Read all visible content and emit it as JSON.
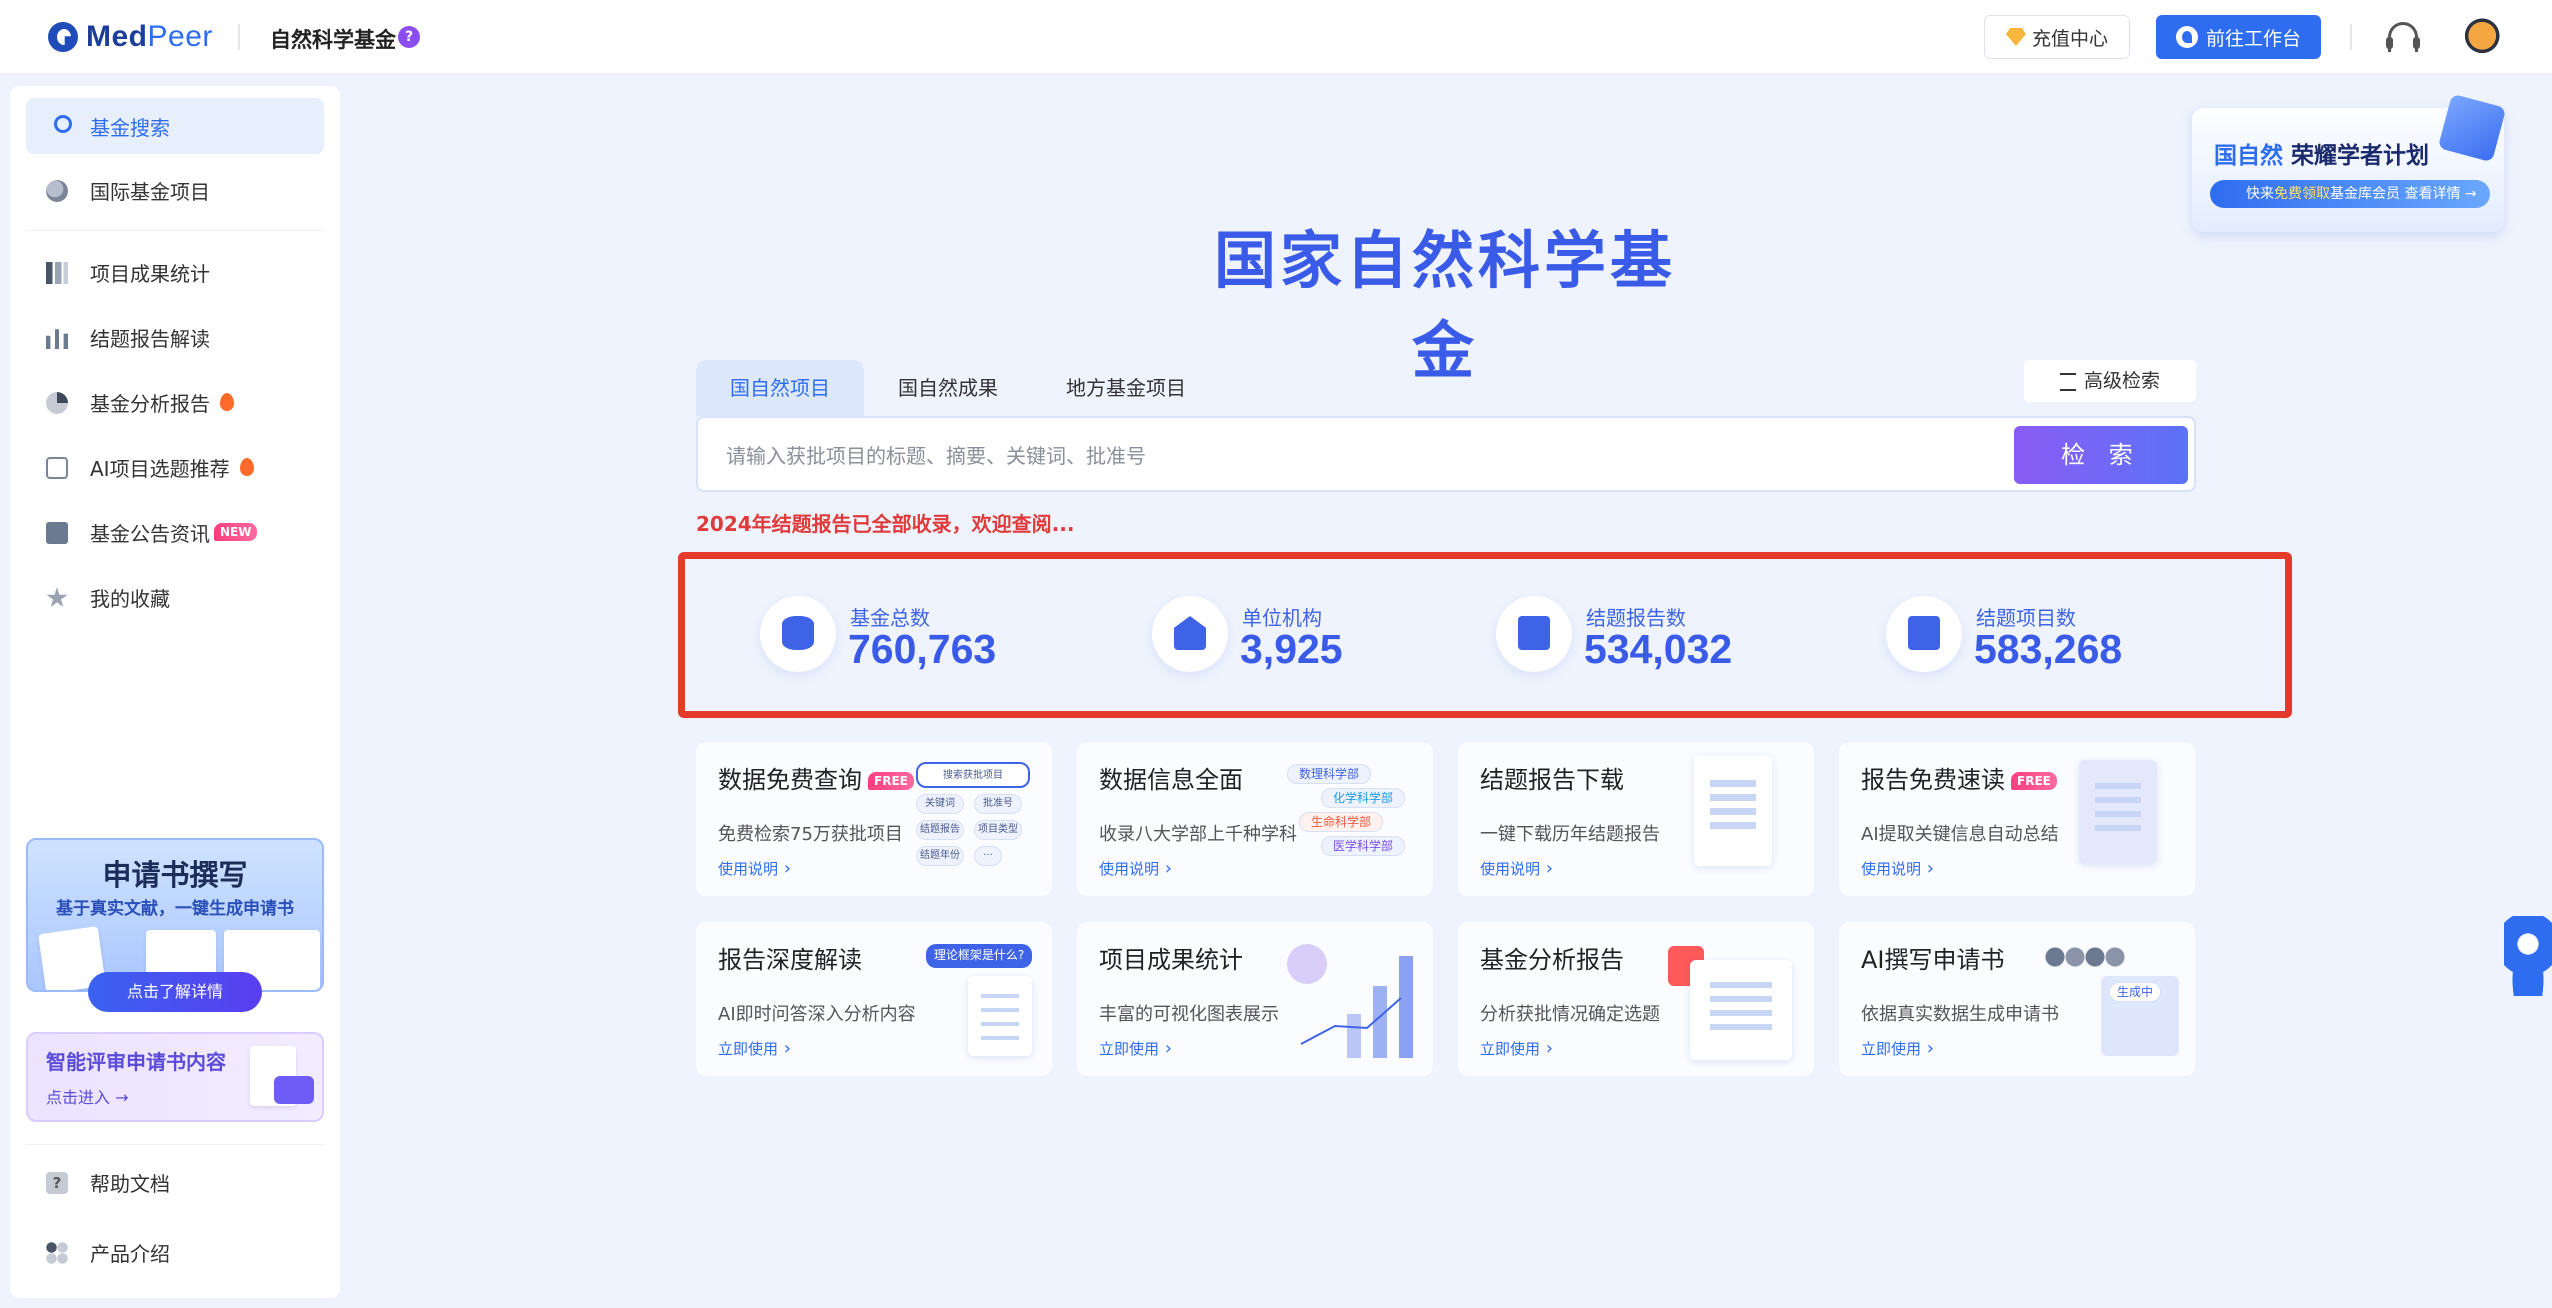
{
  "header": {
    "logo_med": "Med",
    "logo_peer": "Peer",
    "app_title": "自然科学基金",
    "help": "?",
    "recharge_label": "充值中心",
    "workbench_label": "前往工作台"
  },
  "sidebar": {
    "items": [
      {
        "label": "基金搜索",
        "icon": "search-icon",
        "active": true
      },
      {
        "label": "国际基金项目",
        "icon": "globe-icon"
      },
      {
        "label": "项目成果统计",
        "icon": "bar-chart-icon"
      },
      {
        "label": "结题报告解读",
        "icon": "analytics-icon"
      },
      {
        "label": "基金分析报告",
        "icon": "pie-chart-icon",
        "hot": true
      },
      {
        "label": "AI项目选题推荐",
        "icon": "ai-icon",
        "hot": true
      },
      {
        "label": "基金公告资讯",
        "icon": "news-icon",
        "badge": "NEW"
      },
      {
        "label": "我的收藏",
        "icon": "star-icon"
      }
    ],
    "promo_apply": {
      "title": "申请书撰写",
      "subtitle": "基于真实文献，一键生成申请书",
      "button": "点击了解详情"
    },
    "promo_review": {
      "title": "智能评审申请书内容",
      "link": "点击进入 →"
    },
    "bottom": [
      {
        "label": "帮助文档",
        "icon": "help-icon"
      },
      {
        "label": "产品介绍",
        "icon": "product-icon"
      }
    ]
  },
  "banner": {
    "title_a": "国自然",
    "title_b": " 荣耀学者计划",
    "line_a": "快来",
    "line_b": "免费领取",
    "line_c": "基金库会员",
    "line_d": "  查看详情 →"
  },
  "main": {
    "title": "国家自然科学基金",
    "tabs": [
      "国自然项目",
      "国自然成果",
      "地方基金项目"
    ],
    "advanced_search": "高级检索",
    "search_placeholder": "请输入获批项目的标题、摘要、关键词、批准号",
    "search_button": "检 索",
    "notice": "2024年结题报告已全部收录，欢迎查阅...",
    "stats": [
      {
        "label": "基金总数",
        "value": "760,763",
        "icon": "database-icon"
      },
      {
        "label": "单位机构",
        "value": "3,925",
        "icon": "institution-icon"
      },
      {
        "label": "结题报告数",
        "value": "534,032",
        "icon": "report-icon"
      },
      {
        "label": "结题项目数",
        "value": "583,268",
        "icon": "files-icon"
      }
    ],
    "cards": [
      {
        "title": "数据免费查询",
        "free": "FREE",
        "desc": "免费检索75万获批项目",
        "link": "使用说明",
        "art": [
          "搜索获批项目",
          "关键词",
          "批准号",
          "结题报告",
          "项目类型",
          "结题年份",
          "···"
        ]
      },
      {
        "title": "数据信息全面",
        "desc": "收录八大学部上千种学科",
        "link": "使用说明",
        "art": [
          "数理科学部",
          "化学科学部",
          "生命科学部",
          "医学科学部"
        ]
      },
      {
        "title": "结题报告下载",
        "desc": "一键下载历年结题报告",
        "link": "使用说明"
      },
      {
        "title": "报告免费速读",
        "free": "FREE",
        "desc": "AI提取关键信息自动总结",
        "link": "使用说明"
      },
      {
        "title": "报告深度解读",
        "desc": "AI即时问答深入分析内容",
        "link": "立即使用",
        "art": [
          "理论框架是什么?"
        ]
      },
      {
        "title": "项目成果统计",
        "desc": "丰富的可视化图表展示",
        "link": "立即使用"
      },
      {
        "title": "基金分析报告",
        "desc": "分析获批情况确定选题",
        "link": "立即使用"
      },
      {
        "title": "AI撰写申请书",
        "desc": "依据真实数据生成申请书",
        "link": "立即使用",
        "art": [
          "生成中"
        ]
      }
    ]
  }
}
